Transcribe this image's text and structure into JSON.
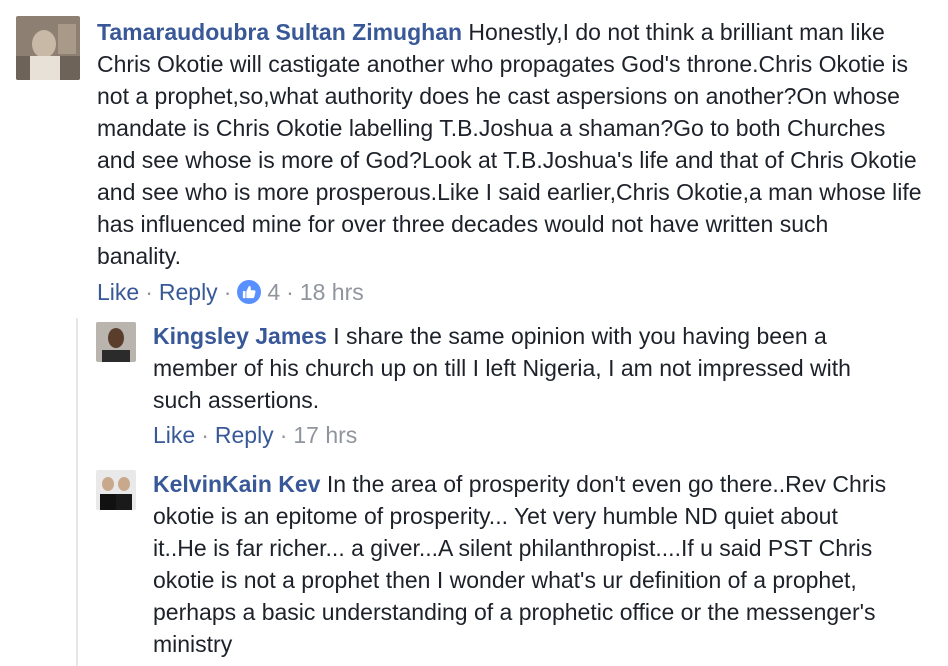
{
  "comments": [
    {
      "author": "Tamaraudoubra Sultan Zimughan",
      "lines": [
        " Honestly,I do not think a brilliant man like",
        "Chris Okotie will castigate another who propagates God's throne.Chris Okotie is",
        "not a prophet,so,what authority does he cast aspersions on another?On whose",
        "mandate is Chris Okotie labelling T.B.Joshua a shaman?Go to both Churches",
        "and see whose is more of God?Look at T.B.Joshua's life and that of Chris Okotie",
        "and see who is more prosperous.Like I said earlier,Chris Okotie,a man whose life",
        "has influenced mine for over three decades would not have written such",
        "banality."
      ],
      "like_label": "Like",
      "reply_label": "Reply",
      "reaction_count": "4",
      "time": "18 hrs"
    },
    {
      "author": "Kingsley James",
      "lines": [
        " I share the same opinion with you having been a",
        "member of his church up on till I left Nigeria, I am not impressed with",
        "such assertions."
      ],
      "like_label": "Like",
      "reply_label": "Reply",
      "time": "17 hrs"
    },
    {
      "author": "KelvinKain Kev",
      "lines": [
        " In the area of prosperity don't even go there..Rev Chris",
        "okotie is an epitome of prosperity... Yet very humble ND quiet about",
        "it..He is far richer... a giver...A silent philanthropist....If u said PST Chris",
        "okotie is not a prophet then I wonder what's ur definition of a prophet,",
        "perhaps a basic understanding of a prophetic office or the messenger's",
        "ministry"
      ]
    }
  ],
  "colors": {
    "link": "#385898",
    "muted": "#90949c",
    "text": "#1d2129",
    "like_badge": "#5890ff"
  },
  "icons": {
    "reaction": "thumbs-up-icon"
  }
}
